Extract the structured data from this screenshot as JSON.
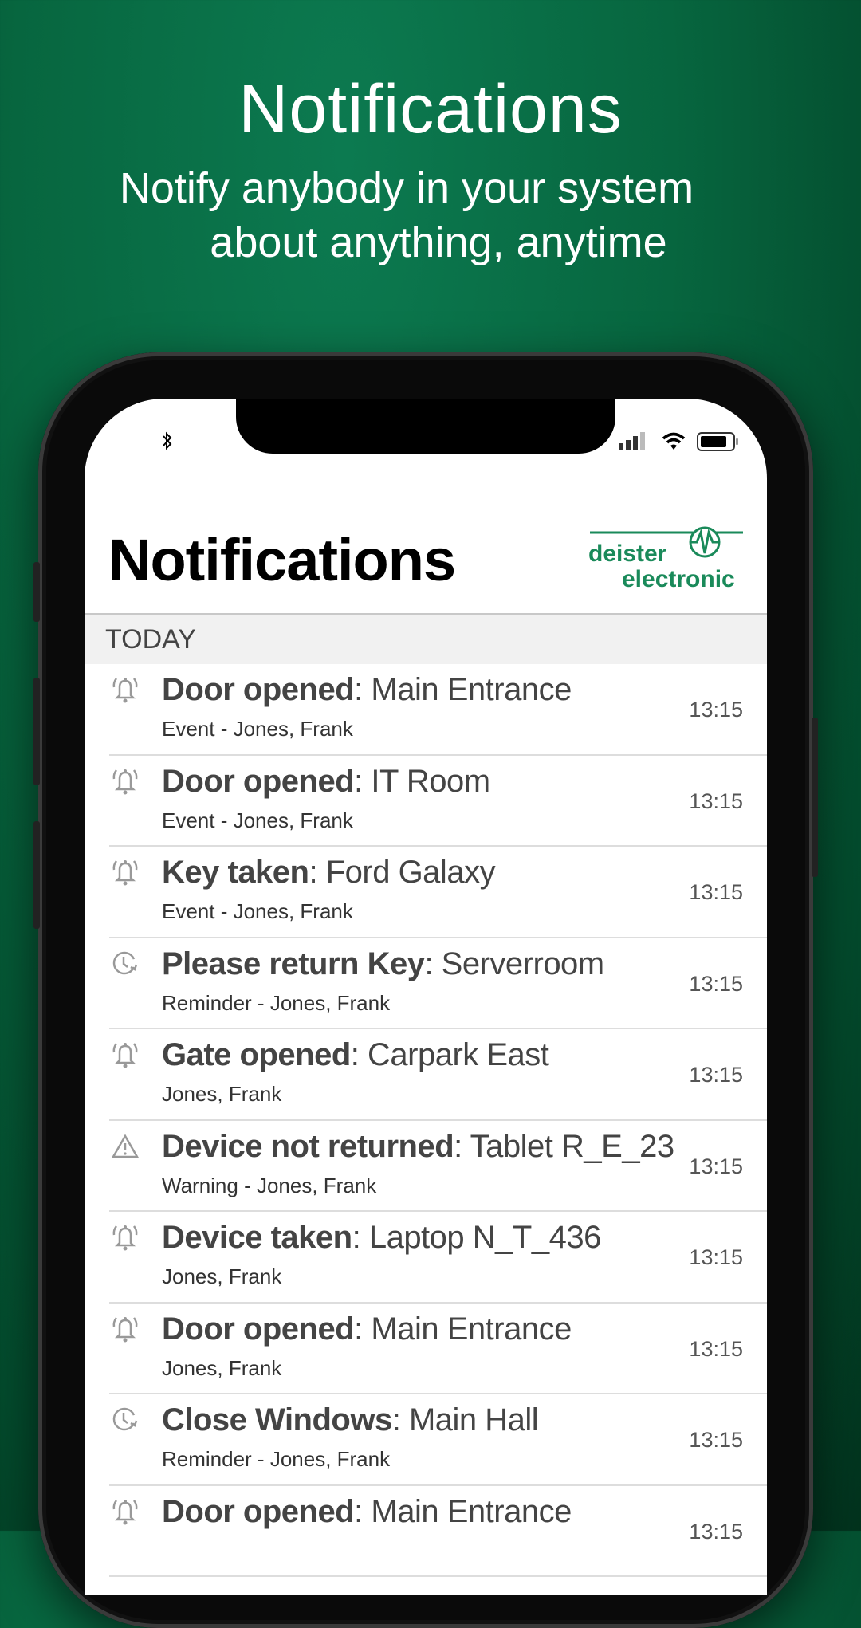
{
  "hero": {
    "title": "Notifications",
    "subtitle_line1": "Notify anybody in your system",
    "subtitle_line2": "about anything, anytime"
  },
  "colors": {
    "background": "#07663f",
    "logo_green": "#1a8a5a"
  },
  "status_bar": {
    "left_icon": "bluetooth-icon",
    "right_icons": [
      "signal-icon",
      "wifi-icon",
      "battery-icon"
    ]
  },
  "header": {
    "title": "Notifications",
    "logo_line1": "deister",
    "logo_line2": "electronic"
  },
  "section": {
    "label": "TODAY"
  },
  "notifications": [
    {
      "icon": "bell",
      "bold": "Door opened",
      "rest": ": Main Entrance",
      "sub": "Event - Jones, Frank",
      "time": "13:15"
    },
    {
      "icon": "bell",
      "bold": "Door opened",
      "rest": ": IT Room",
      "sub": "Event - Jones, Frank",
      "time": "13:15"
    },
    {
      "icon": "bell",
      "bold": "Key taken",
      "rest": ": Ford Galaxy",
      "sub": "Event - Jones, Frank",
      "time": "13:15"
    },
    {
      "icon": "clock",
      "bold": "Please return Key",
      "rest": ": Serverroom",
      "sub": "Reminder - Jones, Frank",
      "time": "13:15"
    },
    {
      "icon": "bell",
      "bold": "Gate opened",
      "rest": ": Carpark East",
      "sub": "Jones, Frank",
      "time": "13:15"
    },
    {
      "icon": "warning",
      "bold": "Device not returned",
      "rest": ": Tablet R_E_23",
      "sub": "Warning - Jones, Frank",
      "time": "13:15"
    },
    {
      "icon": "bell",
      "bold": "Device taken",
      "rest": ": Laptop N_T_436",
      "sub": "Jones, Frank",
      "time": "13:15"
    },
    {
      "icon": "bell",
      "bold": "Door opened",
      "rest": ": Main Entrance",
      "sub": "Jones, Frank",
      "time": "13:15"
    },
    {
      "icon": "clock",
      "bold": "Close Windows",
      "rest": ": Main Hall",
      "sub": "Reminder - Jones, Frank",
      "time": "13:15"
    },
    {
      "icon": "bell",
      "bold": "Door opened",
      "rest": ": Main Entrance",
      "sub": "",
      "time": "13:15"
    }
  ]
}
